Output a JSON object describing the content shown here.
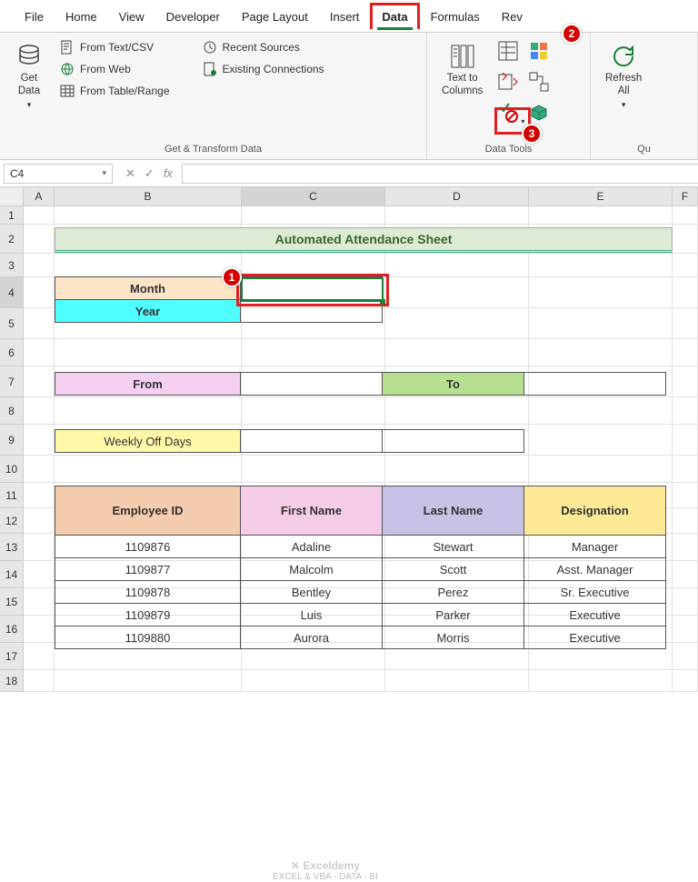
{
  "tabs": [
    "File",
    "Home",
    "View",
    "Developer",
    "Page Layout",
    "Insert",
    "Data",
    "Formulas",
    "Rev"
  ],
  "active_tab": "Data",
  "ribbon": {
    "group1": {
      "label": "Get & Transform Data",
      "get_data": "Get\nData",
      "from_text": "From Text/CSV",
      "from_web": "From Web",
      "from_table": "From Table/Range",
      "recent": "Recent Sources",
      "existing": "Existing Connections"
    },
    "group2": {
      "label": "Data Tools",
      "text_to_cols": "Text to\nColumns"
    },
    "group3": {
      "label": "Qu",
      "refresh": "Refresh\nAll"
    }
  },
  "namebox": "C4",
  "callouts": {
    "c1": "1",
    "c2": "2",
    "c3": "3"
  },
  "col_headers": [
    "A",
    "B",
    "C",
    "D",
    "E",
    "F"
  ],
  "row_headers": [
    "1",
    "2",
    "3",
    "4",
    "5",
    "6",
    "7",
    "8",
    "9",
    "10",
    "11",
    "12",
    "13",
    "14",
    "15",
    "16",
    "17",
    "18"
  ],
  "title": "Automated Attendance Sheet",
  "labels": {
    "month": "Month",
    "year": "Year",
    "from": "From",
    "to": "To",
    "off": "Weekly Off Days"
  },
  "emp_headers": [
    "Employee ID",
    "First Name",
    "Last Name",
    "Designation"
  ],
  "emp_rows": [
    [
      "1109876",
      "Adaline",
      "Stewart",
      "Manager"
    ],
    [
      "1109877",
      "Malcolm",
      "Scott",
      "Asst. Manager"
    ],
    [
      "1109878",
      "Bentley",
      "Perez",
      "Sr. Executive"
    ],
    [
      "1109879",
      "Luis",
      "Parker",
      "Executive"
    ],
    [
      "1109880",
      "Aurora",
      "Morris",
      "Executive"
    ]
  ],
  "watermark": {
    "brand": "Exceldemy",
    "tag": "EXCEL & VBA - DATA - BI"
  }
}
